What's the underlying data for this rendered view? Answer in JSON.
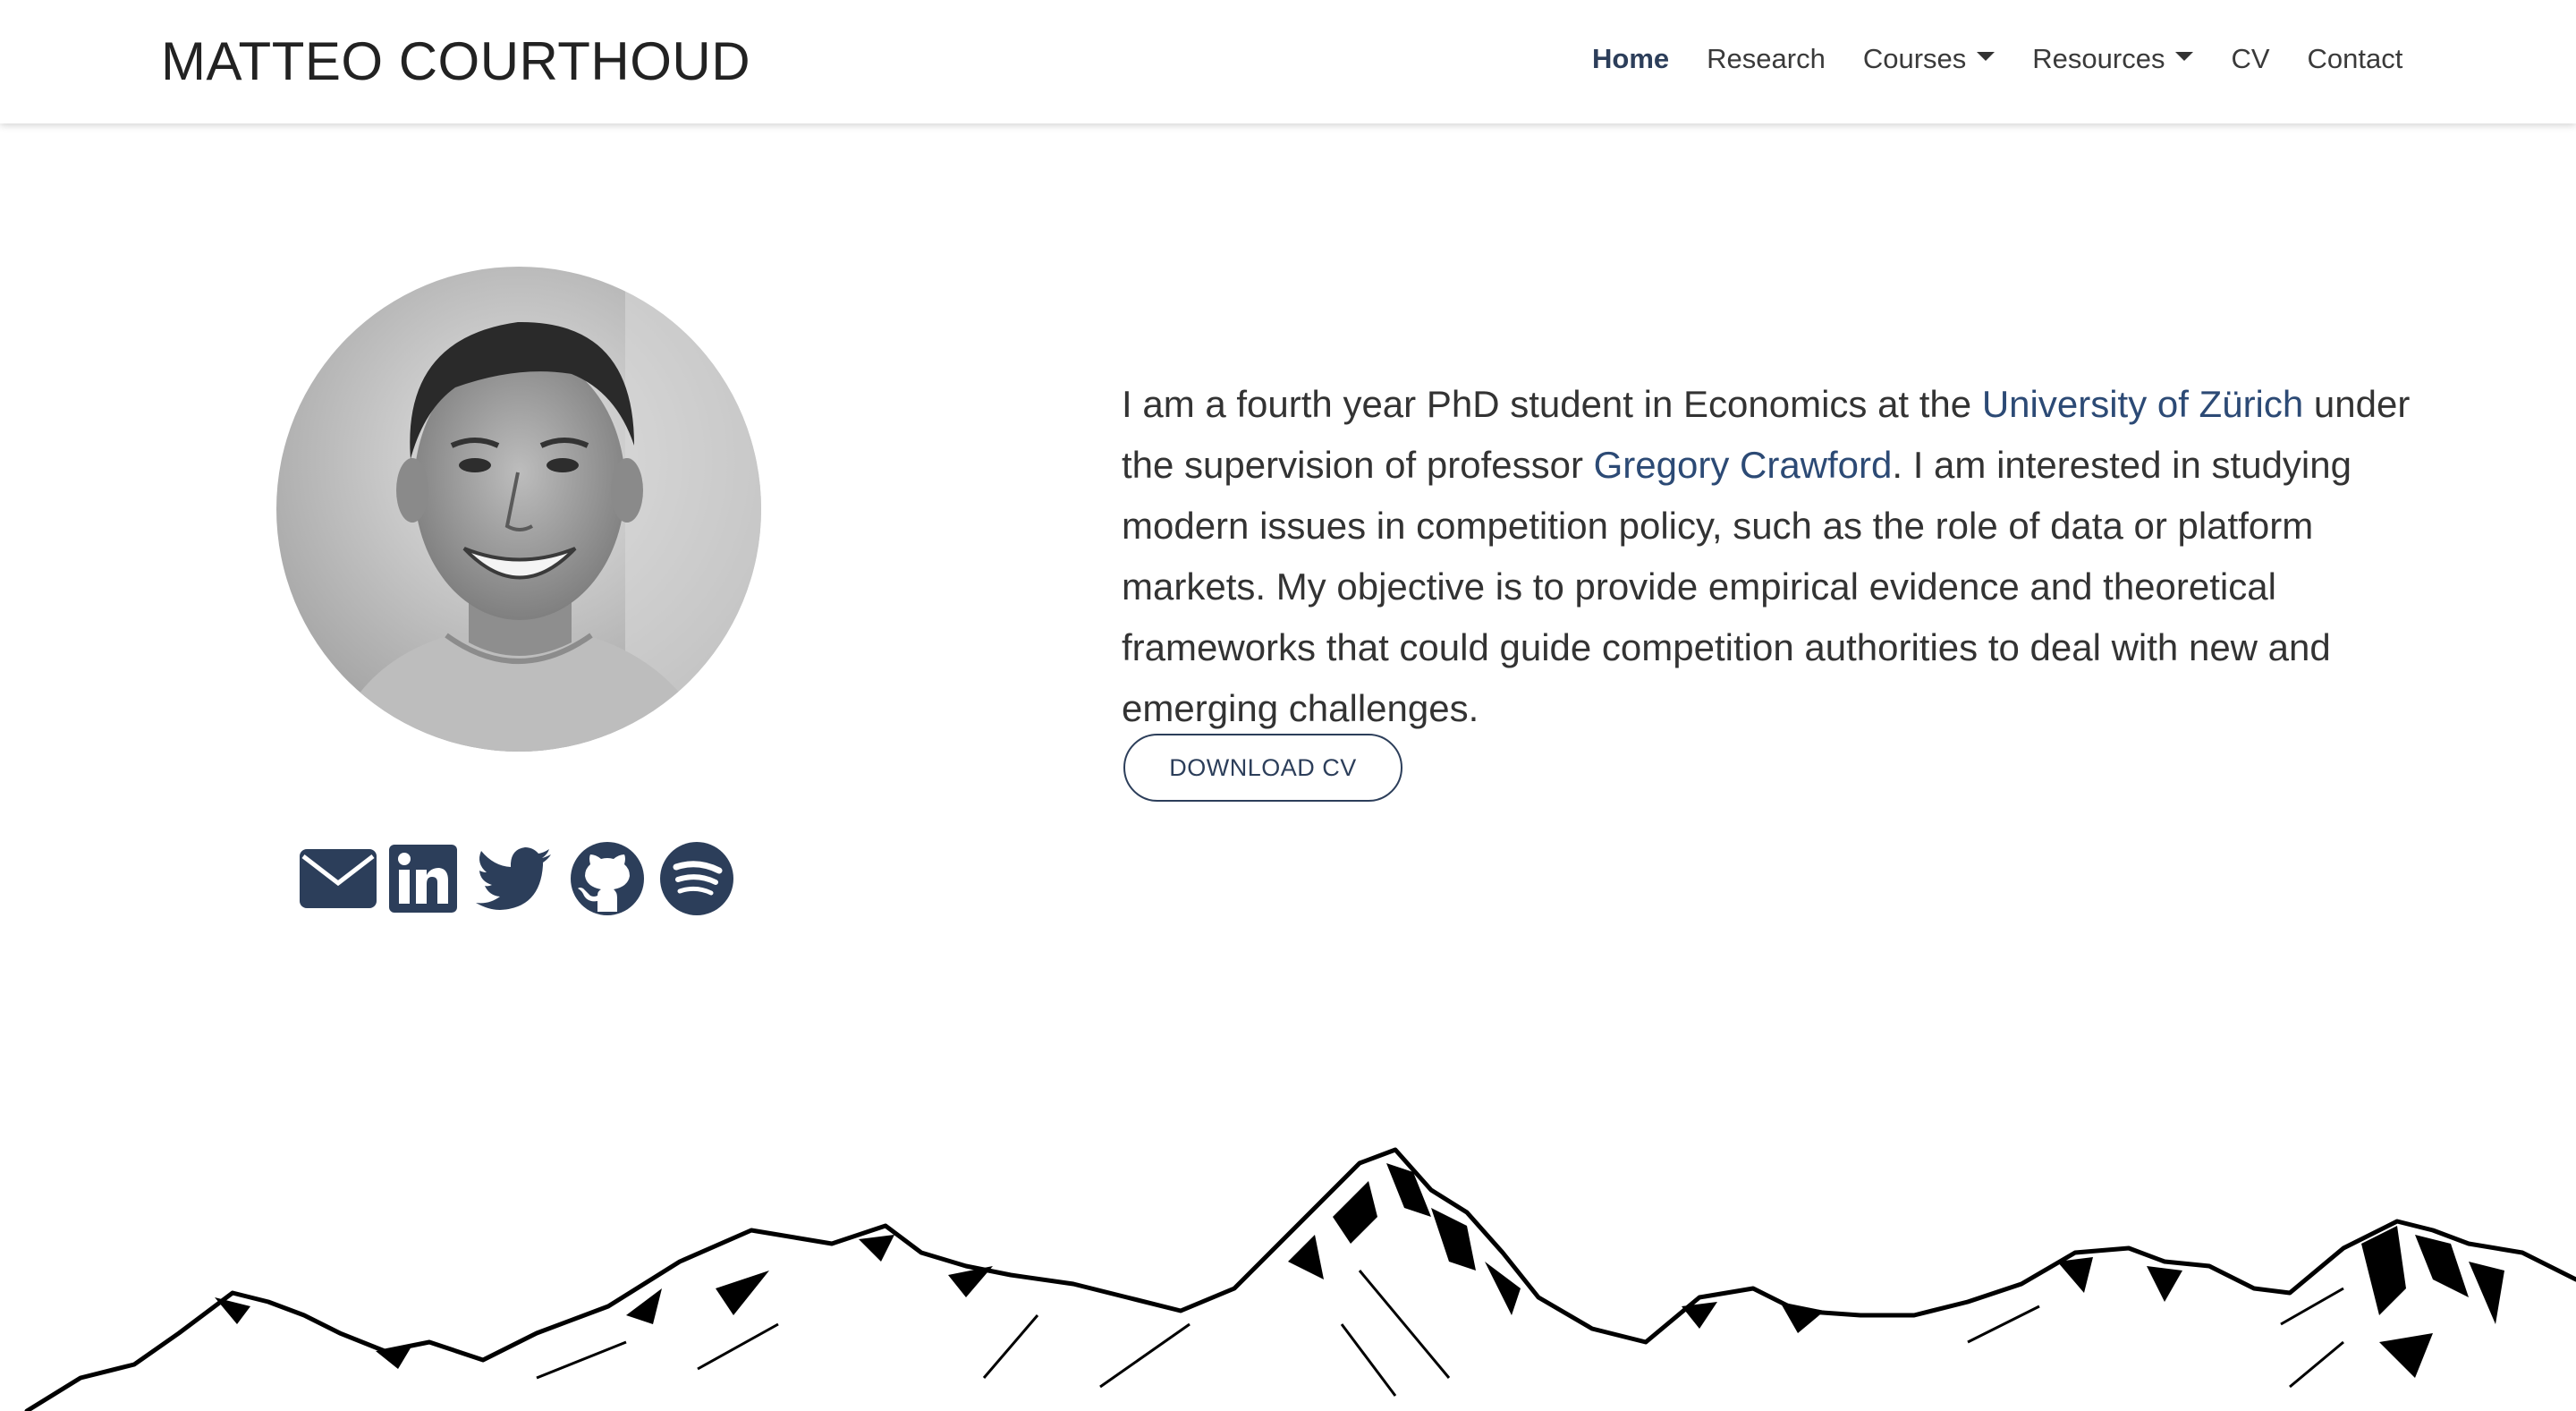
{
  "navbar": {
    "brand": "MATTEO COURTHOUD",
    "items": [
      {
        "label": "Home",
        "active": true,
        "dropdown": false
      },
      {
        "label": "Research",
        "active": false,
        "dropdown": false
      },
      {
        "label": "Courses",
        "active": false,
        "dropdown": true
      },
      {
        "label": "Resources",
        "active": false,
        "dropdown": true
      },
      {
        "label": "CV",
        "active": false,
        "dropdown": false
      },
      {
        "label": "Contact",
        "active": false,
        "dropdown": false
      }
    ]
  },
  "bio": {
    "part1": "I am a fourth year PhD student in Economics at the ",
    "link1": "University of Zürich",
    "part2": " under the supervision of professor ",
    "link2": "Gregory Crawford",
    "part3": ". I am interested in studying modern issues in competition policy, such as the role of data or platform markets. My objective is to provide empirical evidence and theoretical frameworks that could guide competition authorities to deal with new and emerging challenges."
  },
  "cv_button": {
    "label": "DOWNLOAD CV"
  },
  "social": {
    "icons": [
      "envelope-icon",
      "linkedin-icon",
      "twitter-icon",
      "github-icon",
      "spotify-icon"
    ]
  },
  "colors": {
    "accent": "#2c3e5a",
    "link": "#2c4a75",
    "icon": "#2c3e5a"
  }
}
